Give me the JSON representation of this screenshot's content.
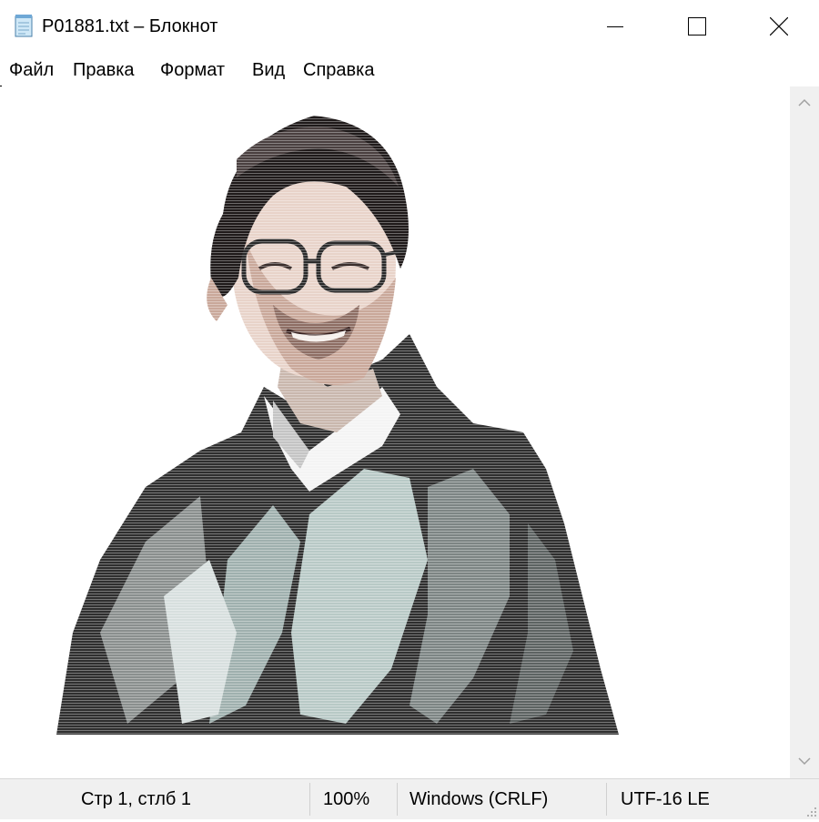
{
  "window": {
    "title": "P01881.txt – Блокнот"
  },
  "menu": [
    "Файл",
    "Правка",
    "Формат",
    "Вид",
    "Справка"
  ],
  "status": {
    "position": "Стр 1, стлб 1",
    "zoom": "100%",
    "line_endings": "Windows (CRLF)",
    "encoding": "UTF-16 LE"
  },
  "document": {
    "content_image": "ascii-art-portrait"
  },
  "icons": {
    "app": "notepad-icon",
    "minimize": "minimize-icon",
    "maximize": "maximize-icon",
    "close": "close-icon",
    "scroll_up": "chevron-up-icon",
    "scroll_down": "chevron-down-icon",
    "resize": "resize-grip-icon"
  }
}
